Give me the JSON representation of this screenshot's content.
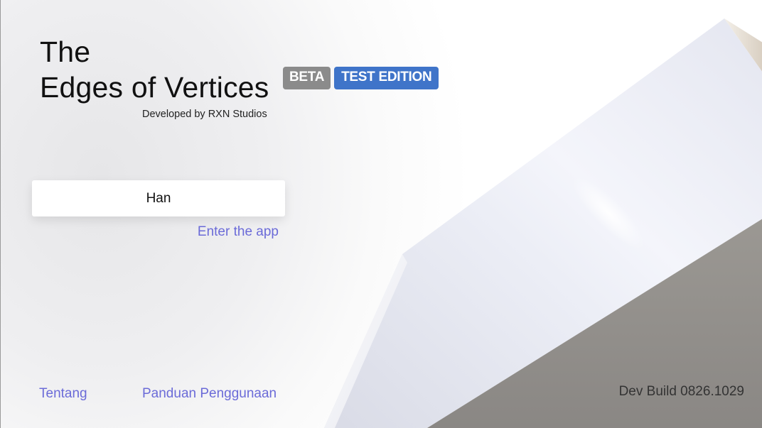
{
  "app": {
    "title_line1": "The",
    "title_line2": "Edges of Vertices",
    "developer": "Developed by RXN Studios"
  },
  "badges": {
    "beta": "BETA",
    "test": "TEST EDITION"
  },
  "colors": {
    "accent_link": "#6b6bd8",
    "badge_beta": "#8b8b8b",
    "badge_test": "#3f74c9"
  },
  "login": {
    "name_value": "Han",
    "enter_label": "Enter the app"
  },
  "footer": {
    "about_label": "Tentang",
    "guide_label": "Panduan Penggunaan",
    "build_label": "Dev Build 0826.1029"
  }
}
